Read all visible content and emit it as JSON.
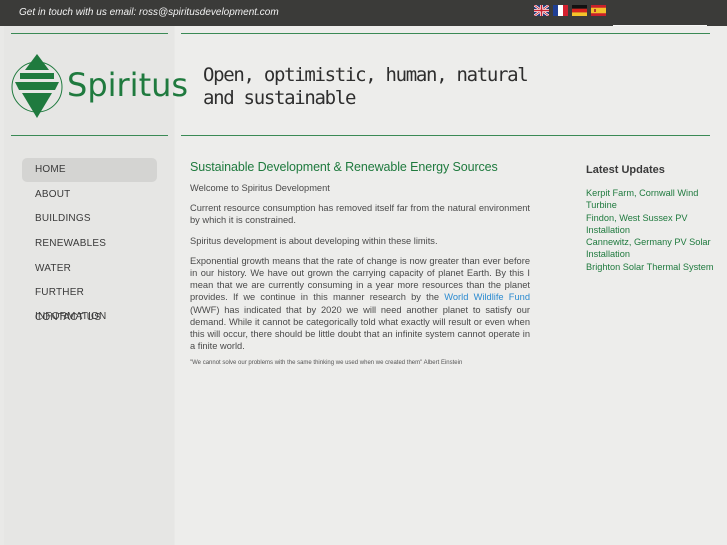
{
  "topbar": {
    "contact_text": "Get in touch with us email: ross@spiritusdevelopment.com",
    "languages": [
      "English",
      "Français",
      "Deutsch",
      "Español"
    ]
  },
  "brand": {
    "name": "Spiritus",
    "tagline_line1": "Open, optimistic, human, natural",
    "tagline_line2": "and sustainable"
  },
  "nav": {
    "items": [
      {
        "label": "HOME",
        "active": true
      },
      {
        "label": "ABOUT"
      },
      {
        "label": "BUILDINGS"
      },
      {
        "label": "RENEWABLES"
      },
      {
        "label": "WATER"
      },
      {
        "label": "FURTHER INFORMATION"
      },
      {
        "label": "CONTACT US"
      }
    ]
  },
  "main": {
    "heading": "Sustainable Development & Renewable Energy Sources",
    "p1": "Welcome to Spiritus Development",
    "p2": "Current resource consumption has removed itself far from the natural environment by which it is constrained.",
    "p3": "Spiritus development is about developing within these limits.",
    "p4_before": "Exponential growth means that the rate of change is now greater than ever before in our history. We have out grown the carrying capacity of planet Earth. By this I mean that we are currently consuming in a year more resources than the planet provides. If we continue in this manner research by the ",
    "p4_link": "World Wildlife Fund",
    "p4_after": " (WWF) has indicated that by 2020 we will need another planet to satisfy our demand. While it cannot be categorically told what exactly will result or even when this will occur, there should be little doubt that an infinite system cannot operate in a finite world.",
    "quote": "\"We cannot solve our problems with the same thinking we used when we created them\" Albert Einstein"
  },
  "updates": {
    "title": "Latest Updates",
    "items": [
      "Kerpit Farm, Cornwall Wind Turbine",
      "Findon, West Sussex PV Installation",
      "Cannewitz, Germany PV Solar Installation",
      "Brighton Solar Thermal System"
    ]
  },
  "colors": {
    "brand_green": "#1f7a3e",
    "topbar_bg": "#3b3b39",
    "link_blue": "#2a8ad0"
  }
}
